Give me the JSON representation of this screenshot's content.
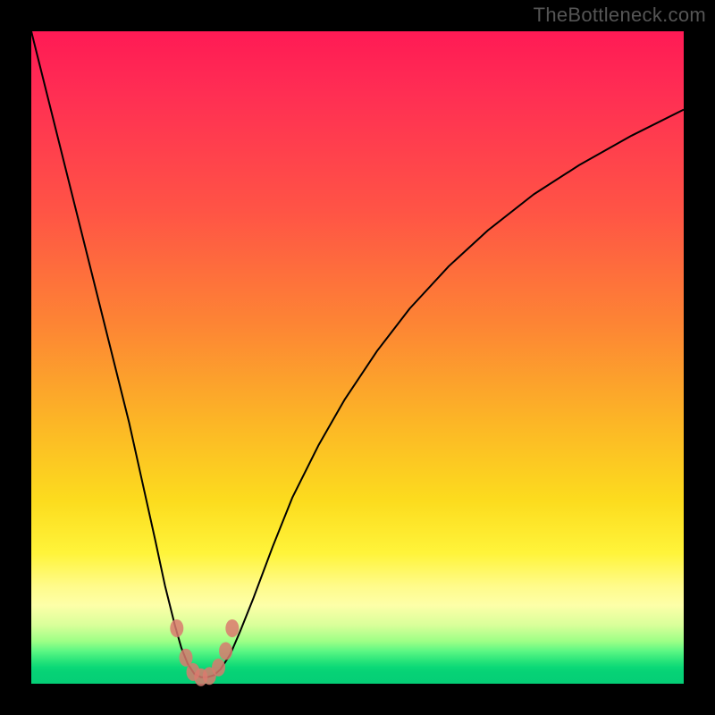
{
  "watermark": "TheBottleneck.com",
  "chart_data": {
    "type": "line",
    "title": "",
    "xlabel": "",
    "ylabel": "",
    "xlim": [
      0,
      100
    ],
    "ylim": [
      0,
      100
    ],
    "grid": false,
    "legend": false,
    "background_gradient": {
      "direction": "vertical",
      "stops": [
        {
          "pos": 0.0,
          "color": "#ff1a55"
        },
        {
          "pos": 0.28,
          "color": "#ff5545"
        },
        {
          "pos": 0.45,
          "color": "#fd8534"
        },
        {
          "pos": 0.6,
          "color": "#fcb626"
        },
        {
          "pos": 0.8,
          "color": "#fff43a"
        },
        {
          "pos": 0.93,
          "color": "#9dff86"
        },
        {
          "pos": 1.0,
          "color": "#05ce76"
        }
      ]
    },
    "series": [
      {
        "name": "bottleneck-curve",
        "color": "#000000",
        "x": [
          0.0,
          3.0,
          6.0,
          9.0,
          12.0,
          15.0,
          17.0,
          19.0,
          20.5,
          22.0,
          23.0,
          24.0,
          25.0,
          26.0,
          27.0,
          28.0,
          29.0,
          30.5,
          32.0,
          34.0,
          37.0,
          40.0,
          44.0,
          48.0,
          53.0,
          58.0,
          64.0,
          70.0,
          77.0,
          84.0,
          92.0,
          100.0
        ],
        "y": [
          100.0,
          88.0,
          76.0,
          64.0,
          52.0,
          40.0,
          31.0,
          22.0,
          15.0,
          9.0,
          5.5,
          3.0,
          1.5,
          1.0,
          1.0,
          1.3,
          2.2,
          4.5,
          8.0,
          13.0,
          21.0,
          28.5,
          36.5,
          43.5,
          51.0,
          57.5,
          64.0,
          69.5,
          75.0,
          79.5,
          84.0,
          88.0
        ]
      },
      {
        "name": "highlight-dots",
        "type": "scatter",
        "color": "#d97a6e",
        "x": [
          22.3,
          23.7,
          24.8,
          26.0,
          27.3,
          28.7,
          29.8,
          30.8
        ],
        "y": [
          8.5,
          4.0,
          1.8,
          1.0,
          1.2,
          2.5,
          5.0,
          8.5
        ]
      }
    ]
  }
}
